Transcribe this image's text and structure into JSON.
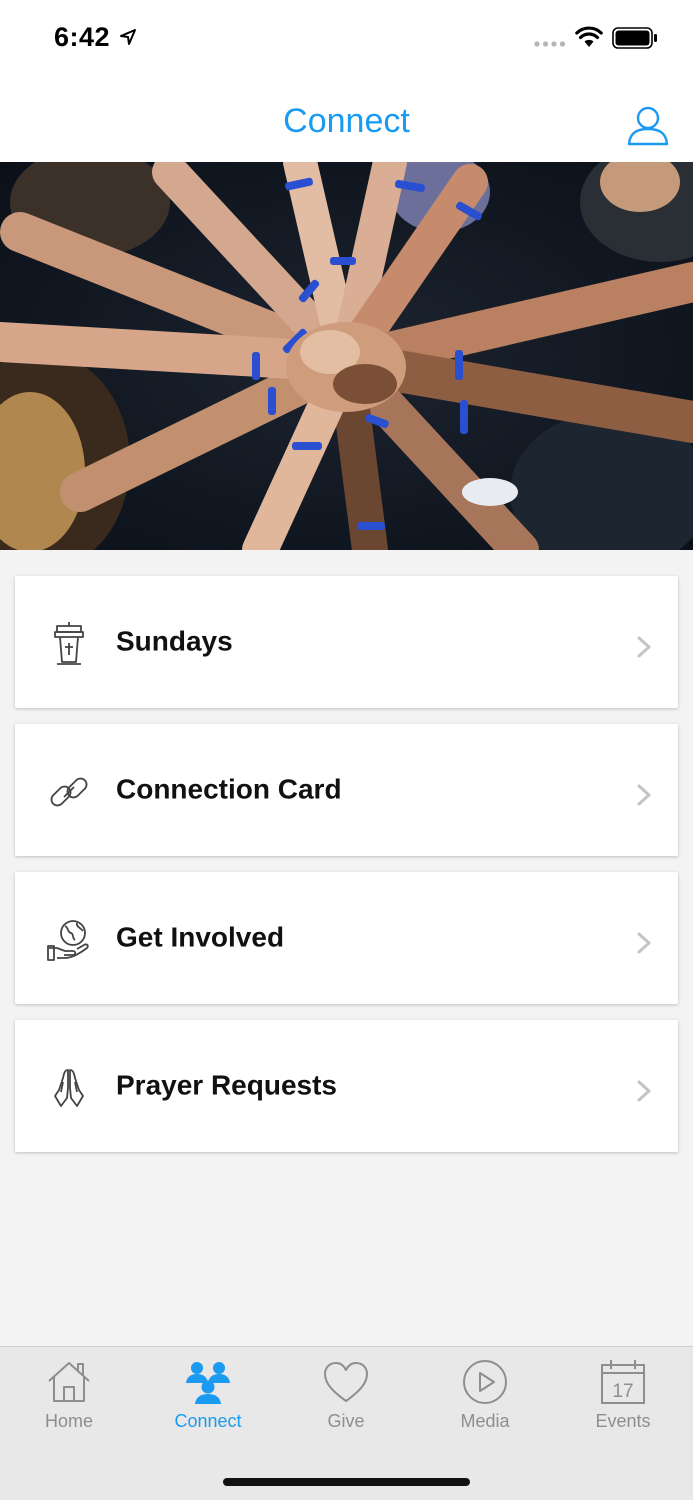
{
  "status": {
    "time": "6:42"
  },
  "nav": {
    "title": "Connect"
  },
  "hero": {
    "description_icon": "photo-icon"
  },
  "items": [
    {
      "label": "Sundays",
      "icon": "pulpit-icon"
    },
    {
      "label": "Connection Card",
      "icon": "link-icon"
    },
    {
      "label": "Get Involved",
      "icon": "globe-hand-icon"
    },
    {
      "label": "Prayer Requests",
      "icon": "praying-hands-icon"
    }
  ],
  "tabs": [
    {
      "label": "Home",
      "icon": "home-icon",
      "active": false
    },
    {
      "label": "Connect",
      "icon": "people-icon",
      "active": true
    },
    {
      "label": "Give",
      "icon": "heart-icon",
      "active": false
    },
    {
      "label": "Media",
      "icon": "play-icon",
      "active": false
    },
    {
      "label": "Events",
      "icon": "calendar-icon",
      "active": false,
      "calendar_day": "17"
    }
  ],
  "colors": {
    "accent": "#1a9af0",
    "inactive": "#8e8e8e",
    "background": "#f3f3f3"
  }
}
